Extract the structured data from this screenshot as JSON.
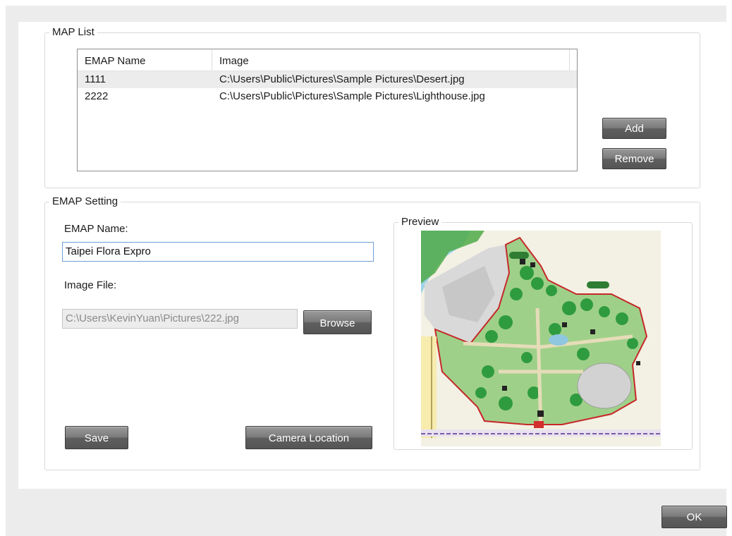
{
  "map_list": {
    "title": "MAP List",
    "columns": [
      "EMAP Name",
      "Image"
    ],
    "rows": [
      {
        "name": "1111",
        "image": "C:\\Users\\Public\\Pictures\\Sample Pictures\\Desert.jpg",
        "selected": true
      },
      {
        "name": "2222",
        "image": "C:\\Users\\Public\\Pictures\\Sample Pictures\\Lighthouse.jpg",
        "selected": false
      }
    ],
    "add_label": "Add",
    "remove_label": "Remove"
  },
  "emap_setting": {
    "title": "EMAP Setting",
    "name_label": "EMAP Name:",
    "name_value": "Taipei Flora Expro",
    "image_file_label": "Image File:",
    "image_file_value": "C:\\Users\\KevinYuan\\Pictures\\222.jpg",
    "browse_label": "Browse",
    "save_label": "Save",
    "camera_location_label": "Camera Location",
    "preview_title": "Preview"
  },
  "footer": {
    "ok_label": "OK"
  },
  "colors": {
    "button_dark": "#5f5f5f",
    "input_focus_border": "#6d9fd4",
    "map_park_green": "#2f9b3f",
    "map_boundary_red": "#c62828"
  }
}
